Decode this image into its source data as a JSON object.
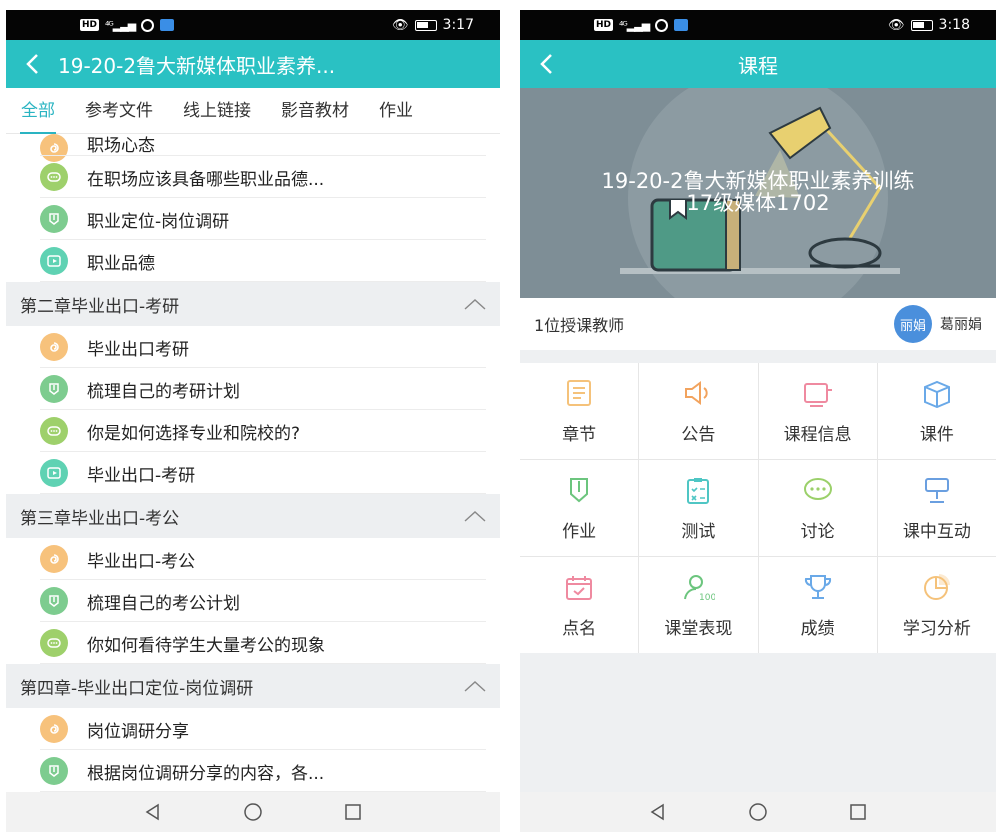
{
  "left": {
    "status": {
      "time": "3:17",
      "hd": "HD",
      "net": "4G"
    },
    "title": "19-20-2鲁大新媒体职业素养...",
    "tabs": [
      "全部",
      "参考文件",
      "线上链接",
      "影音教材",
      "作业"
    ],
    "active_tab": "全部",
    "partial_item": {
      "type": "link",
      "label": "职场心态"
    },
    "top_items": [
      {
        "type": "discuss",
        "label": "在职场应该具备哪些职业品德..."
      },
      {
        "type": "homework",
        "label": "职业定位-岗位调研"
      },
      {
        "type": "video",
        "label": "职业品德"
      }
    ],
    "chapters": [
      {
        "title": "第二章毕业出口-考研",
        "items": [
          {
            "type": "link",
            "label": "毕业出口考研"
          },
          {
            "type": "homework",
            "label": "梳理自己的考研计划"
          },
          {
            "type": "discuss",
            "label": "你是如何选择专业和院校的?"
          },
          {
            "type": "video",
            "label": "毕业出口-考研"
          }
        ]
      },
      {
        "title": "第三章毕业出口-考公",
        "items": [
          {
            "type": "link",
            "label": "毕业出口-考公"
          },
          {
            "type": "homework",
            "label": "梳理自己的考公计划"
          },
          {
            "type": "discuss",
            "label": "你如何看待学生大量考公的现象"
          }
        ]
      },
      {
        "title": "第四章-毕业出口定位-岗位调研",
        "items": [
          {
            "type": "link",
            "label": "岗位调研分享"
          },
          {
            "type": "homework",
            "label": "根据岗位调研分享的内容，各..."
          }
        ]
      }
    ]
  },
  "right": {
    "status": {
      "time": "3:18",
      "hd": "HD",
      "net": "4G"
    },
    "title": "课程",
    "banner_line1": "19-20-2鲁大新媒体职业素养训练",
    "banner_line2": "17级媒体1702",
    "teacher_count": "1位授课教师",
    "teacher_avatar": "丽娟",
    "teacher_name": "葛丽娟",
    "grid": [
      {
        "label": "章节",
        "icon": "chapter-icon",
        "color": "#f5c27a"
      },
      {
        "label": "公告",
        "icon": "announcement-icon",
        "color": "#f2a35e"
      },
      {
        "label": "课程信息",
        "icon": "course-info-icon",
        "color": "#ef8aa0"
      },
      {
        "label": "课件",
        "icon": "courseware-icon",
        "color": "#6aa9e8"
      },
      {
        "label": "作业",
        "icon": "homework-icon",
        "color": "#6cc57e"
      },
      {
        "label": "测试",
        "icon": "test-icon",
        "color": "#4fc6c4"
      },
      {
        "label": "讨论",
        "icon": "discussion-icon",
        "color": "#9bd06a"
      },
      {
        "label": "课中互动",
        "icon": "interaction-icon",
        "color": "#6a9fe0"
      },
      {
        "label": "点名",
        "icon": "roll-call-icon",
        "color": "#ef8aa0"
      },
      {
        "label": "课堂表现",
        "icon": "performance-icon",
        "color": "#6cc57e"
      },
      {
        "label": "成绩",
        "icon": "trophy-icon",
        "color": "#6aa9e8"
      },
      {
        "label": "学习分析",
        "icon": "pie-chart-icon",
        "color": "#f5c27a"
      }
    ]
  }
}
